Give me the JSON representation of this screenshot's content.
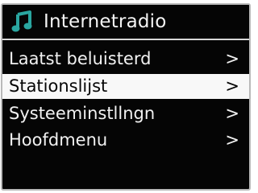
{
  "header": {
    "title": "Internetradio",
    "icon": "music-note-icon",
    "icon_color": "#2aa6a0"
  },
  "menu": {
    "items": [
      {
        "label": "Laatst beluisterd",
        "chevron": ">",
        "selected": false
      },
      {
        "label": "Stationslijst",
        "chevron": ">",
        "selected": true
      },
      {
        "label": "Systeeminstllngn",
        "chevron": ">",
        "selected": false
      },
      {
        "label": "Hoofdmenu",
        "chevron": ">",
        "selected": false
      }
    ]
  },
  "colors": {
    "screen_background": "#050505",
    "text": "#f2f2f2",
    "selection_background": "#f8f8f8",
    "selection_text": "#050505"
  }
}
